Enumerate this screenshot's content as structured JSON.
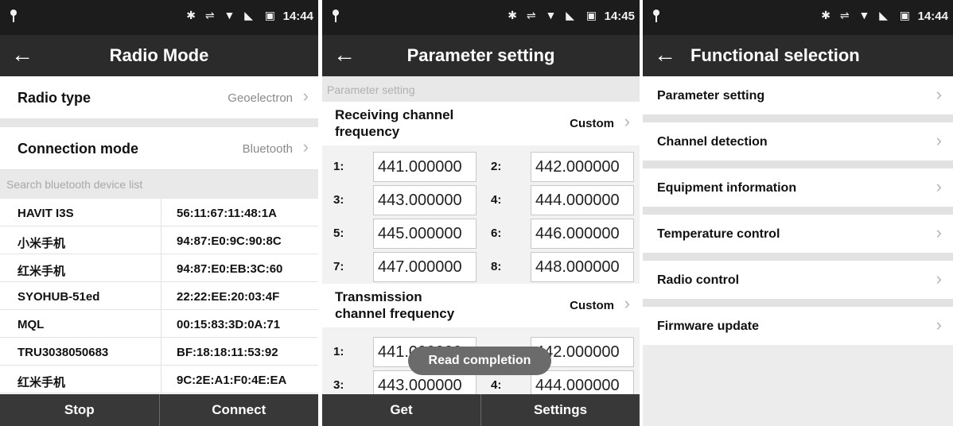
{
  "status_bar": {
    "icons": "✱ ⇌ ▼ ◣",
    "battery_icon": "▣",
    "times": [
      "14:44",
      "14:45",
      "14:44"
    ]
  },
  "radio_mode": {
    "title": "Radio Mode",
    "radio_type": {
      "label": "Radio type",
      "value": "Geoelectron"
    },
    "connection_mode": {
      "label": "Connection mode",
      "value": "Bluetooth"
    },
    "search_header": "Search bluetooth device list",
    "devices": [
      {
        "name": "HAVIT I3S",
        "mac": "56:11:67:11:48:1A"
      },
      {
        "name": "小米手机",
        "mac": "94:87:E0:9C:90:8C"
      },
      {
        "name": "红米手机",
        "mac": "94:87:E0:EB:3C:60"
      },
      {
        "name": "SYOHUB-51ed",
        "mac": "22:22:EE:20:03:4F"
      },
      {
        "name": "MQL",
        "mac": "00:15:83:3D:0A:71"
      },
      {
        "name": "TRU3038050683",
        "mac": "BF:18:18:11:53:92"
      },
      {
        "name": "红米手机",
        "mac": "9C:2E:A1:F0:4E:EA"
      }
    ],
    "buttons": {
      "stop": "Stop",
      "connect": "Connect"
    }
  },
  "parameter_setting": {
    "title": "Parameter setting",
    "section_header": "Parameter setting",
    "receiving": {
      "label_line1": "Receiving channel",
      "label_line2": "frequency",
      "value": "Custom",
      "channels": [
        {
          "idx": "1:",
          "freq": "441.000000"
        },
        {
          "idx": "2:",
          "freq": "442.000000"
        },
        {
          "idx": "3:",
          "freq": "443.000000"
        },
        {
          "idx": "4:",
          "freq": "444.000000"
        },
        {
          "idx": "5:",
          "freq": "445.000000"
        },
        {
          "idx": "6:",
          "freq": "446.000000"
        },
        {
          "idx": "7:",
          "freq": "447.000000"
        },
        {
          "idx": "8:",
          "freq": "448.000000"
        }
      ]
    },
    "transmission": {
      "label_line1": "Transmission",
      "label_line2": "channel frequency",
      "value": "Custom",
      "channels": [
        {
          "idx": "1:",
          "freq": "441.000000"
        },
        {
          "idx": "2:",
          "freq": "442.000000"
        },
        {
          "idx": "3:",
          "freq": "443.000000"
        },
        {
          "idx": "4:",
          "freq": "444.000000"
        }
      ]
    },
    "toast": "Read completion",
    "buttons": {
      "get": "Get",
      "settings": "Settings"
    }
  },
  "functional_selection": {
    "title": "Functional selection",
    "items": [
      "Parameter setting",
      "Channel detection",
      "Equipment information",
      "Temperature control",
      "Radio control",
      "Firmware update"
    ]
  },
  "glyphs": {
    "back": "←",
    "chevron": "›"
  }
}
